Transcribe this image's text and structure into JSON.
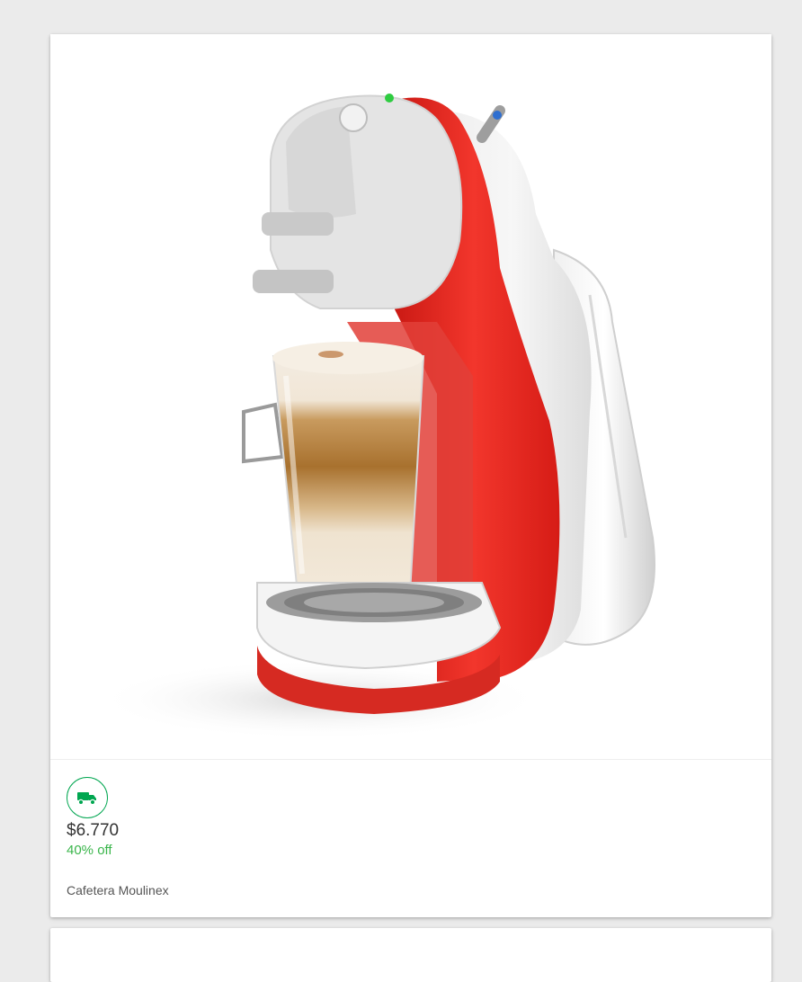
{
  "products": [
    {
      "image_alt": "Cafetera Moulinex",
      "shipping_icon": "truck-icon",
      "price": "$6.770",
      "discount": "40% off",
      "title": "Cafetera Moulinex"
    }
  ],
  "colors": {
    "page_background": "#ebebeb",
    "card_background": "#ffffff",
    "shipping_green": "#00a650",
    "discount_green": "#39b54a",
    "price_text": "#333333",
    "title_text": "#555555",
    "machine_red": "#e8261f"
  }
}
